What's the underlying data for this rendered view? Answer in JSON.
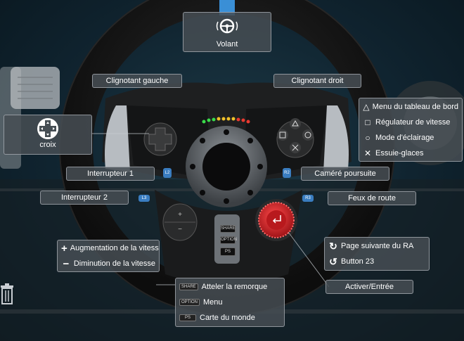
{
  "labels": {
    "volant": "Volant",
    "clignotant_gauche": "Clignotant gauche",
    "clignotant_droit": "Clignotant droit",
    "croix": "croix",
    "interrupteur_1": "Interrupteur 1",
    "interrupteur_2": "Interrupteur 2",
    "camera_poursuite": "Caméré poursuite",
    "feux_de_route": "Feux de route",
    "activer_entree": "Activer/Entrée"
  },
  "face_buttons": [
    {
      "icon": "triangle-icon",
      "symbol": "△",
      "label": "Menu du tableau de bord"
    },
    {
      "icon": "square-icon",
      "symbol": "□",
      "label": "Régulateur de vitesse"
    },
    {
      "icon": "circle-icon",
      "symbol": "○",
      "label": "Mode d'éclairage"
    },
    {
      "icon": "cross-icon",
      "symbol": "✕",
      "label": "Essuie-glaces"
    }
  ],
  "plus_minus": [
    {
      "icon": "plus-icon",
      "symbol": "+",
      "label": "Augmentation de la vitesse"
    },
    {
      "icon": "minus-icon",
      "symbol": "−",
      "label": "Diminution de la vitesse"
    }
  ],
  "dial": [
    {
      "icon": "rotate-clockwise-icon",
      "symbol": "↻",
      "label": "Page suivante du RA"
    },
    {
      "icon": "rotate-counterclockwise-icon",
      "symbol": "↺",
      "label": "Button 23"
    }
  ],
  "center_buttons": [
    {
      "icon": "share-button-icon",
      "tag": "SHARE",
      "label": "Atteler la remorque"
    },
    {
      "icon": "option-button-icon",
      "tag": "OPTION",
      "label": "Menu"
    },
    {
      "icon": "playstation-button-icon",
      "tag": "PS",
      "label": "Carte du monde"
    }
  ],
  "wheel_tags": {
    "l3": "L3",
    "r3": "R3",
    "l2": "L2",
    "r2": "R2",
    "share": "SHARE",
    "option": "OPTION",
    "ps": "PS"
  },
  "colors": {
    "accent": "#3a8fd6",
    "red_dial": "#d2262a",
    "label_bg": "#464e54"
  }
}
